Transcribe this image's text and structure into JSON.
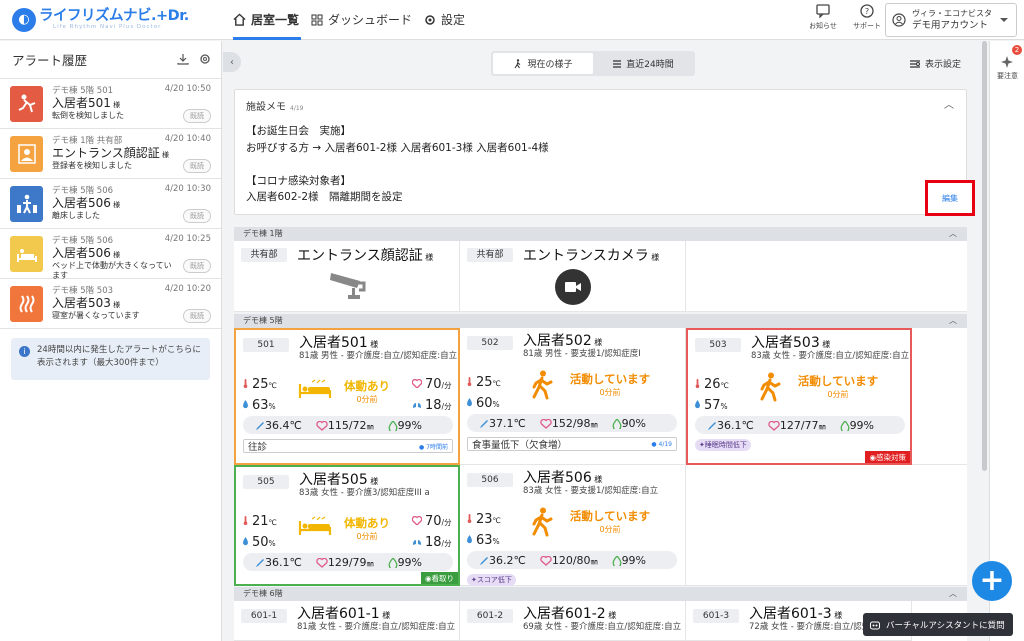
{
  "app": {
    "logo_text": "ライフリズムナビ.+Dr.",
    "logo_sub": "Life Rhythm Navi Plus Doctor"
  },
  "nav": {
    "tabs": [
      {
        "label": "居室一覧"
      },
      {
        "label": "ダッシュボード"
      },
      {
        "label": "設定"
      }
    ]
  },
  "header": {
    "notifications_label": "お知らせ",
    "support_label": "サポート",
    "account_facility": "ヴィラ・エコナビスタ",
    "account_name": "デモ用アカウント",
    "attention_label": "要注意",
    "attention_badge": "2"
  },
  "sidebar": {
    "title": "アラート履歴",
    "info": "24時間以内に発生したアラートがこちらに表示されます（最大300件まで）",
    "alerts": [
      {
        "meta": "デモ棟 5階 501",
        "time": "4/20 10:50",
        "name": "入居者501",
        "suffix": "様",
        "desc": "転倒を検知しました",
        "read": "既読",
        "color": "#e35b43"
      },
      {
        "meta": "デモ棟 1階 共有部",
        "time": "4/20 10:40",
        "name": "エントランス顔認証",
        "suffix": "様",
        "desc": "登録者を検知しました",
        "read": "既読",
        "color": "#f4a340"
      },
      {
        "meta": "デモ棟 5階 506",
        "time": "4/20 10:30",
        "name": "入居者506",
        "suffix": "様",
        "desc": "離床しました",
        "read": "既読",
        "color": "#3e78c9"
      },
      {
        "meta": "デモ棟 5階 506",
        "time": "4/20 10:25",
        "name": "入居者506",
        "suffix": "様",
        "desc": "ベッド上で体動が大きくなっています",
        "read": "既読",
        "color": "#f2c94c"
      },
      {
        "meta": "デモ棟 5階 503",
        "time": "4/20 10:20",
        "name": "入居者503",
        "suffix": "様",
        "desc": "寝室が暑くなっています",
        "read": "既読",
        "color": "#f0763c"
      }
    ]
  },
  "toolbar": {
    "current_label": "現在の様子",
    "recent_label": "直近24時間",
    "display_settings": "表示設定"
  },
  "memo": {
    "title": "施設メモ",
    "date": "4/19",
    "body": "【お誕生日会　実施】\nお呼びする方 → 入居者601-2様 入居者601-3様 入居者601-4様\n\n【コロナ感染対象者】\n入居者602-2様　隔離期間を設定",
    "edit_label": "編集"
  },
  "sections": {
    "f1": "デモ棟 1階",
    "f5": "デモ棟 5階",
    "f6": "デモ棟 6階"
  },
  "common": {
    "shared_label": "共有部",
    "face_name": "エントランス顔認証",
    "camera_name": "エントランスカメラ",
    "suffix": "様"
  },
  "units": {
    "temp": "℃",
    "hum": "%",
    "pulse": "/分",
    "breath": "/分",
    "spo2": "%"
  },
  "rooms": [
    {
      "room": "501",
      "name": "入居者501",
      "sub": "81歳 男性 - 要介護度:自立/認知症度:自立",
      "temp": "25",
      "hum": "63",
      "status": "体動あり",
      "ago": "0分前",
      "pulse": "70",
      "breath": "18",
      "body": "36.4℃",
      "bp": "115/72",
      "bp_unit": "㎜",
      "spo2": "99%",
      "tag": "往診",
      "tag_date": "● 7時間前"
    },
    {
      "room": "502",
      "name": "入居者502",
      "sub": "81歳 男性 - 要支援1/認知症度I",
      "temp": "25",
      "hum": "60",
      "status": "活動しています",
      "ago": "0分前",
      "body": "37.1℃",
      "bp": "152/98",
      "bp_unit": "㎜",
      "spo2": "90%",
      "tag": "食事量低下（欠食増）",
      "tag_date": "● 4/19"
    },
    {
      "room": "503",
      "name": "入居者503",
      "sub": "83歳 女性 - 要介護度:自立/認知症度:自立",
      "temp": "26",
      "hum": "57",
      "status": "活動しています",
      "ago": "0分前",
      "body": "36.1℃",
      "bp": "127/77",
      "bp_unit": "㎜",
      "spo2": "99%",
      "chip": "睡眠時間低下",
      "corner": "感染対策"
    },
    {
      "room": "505",
      "name": "入居者505",
      "sub": "83歳 女性 - 要介護3/認知症度III a",
      "temp": "21",
      "hum": "50",
      "status": "体動あり",
      "ago": "0分前",
      "pulse": "70",
      "breath": "18",
      "body": "36.1℃",
      "bp": "129/79",
      "bp_unit": "㎜",
      "spo2": "99%",
      "corner": "看取り"
    },
    {
      "room": "506",
      "name": "入居者506",
      "sub": "83歳 女性 - 要支援1/認知症度:自立",
      "temp": "23",
      "hum": "63",
      "status": "活動しています",
      "ago": "0分前",
      "body": "36.2℃",
      "bp": "120/80",
      "bp_unit": "㎜",
      "spo2": "99%",
      "chip": "スコア低下"
    },
    {
      "room": "601-1",
      "name": "入居者601-1",
      "sub": "81歳 女性 - 要介護度:自立/認知症度:自立"
    },
    {
      "room": "601-2",
      "name": "入居者601-2",
      "sub": "69歳 女性 - 要介護度:自立/認知症度:自立"
    },
    {
      "room": "601-3",
      "name": "入居者601-3",
      "sub": "72歳 女性 - 要介護度:自立/認知症度:自立"
    }
  ],
  "assistant": {
    "label": "バーチャルアシスタントに質問"
  },
  "colors": {
    "accent": "#2b7de9",
    "orange": "#f28c00",
    "red_border": "#e60012",
    "green_border": "#4caf50"
  }
}
